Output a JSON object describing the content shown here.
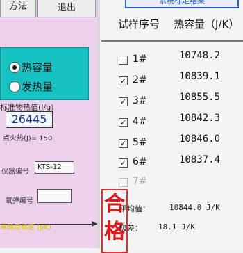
{
  "toolbar": {
    "method_label": "方法",
    "exit_label": "退出"
  },
  "mode": {
    "options": [
      {
        "label": "热容量",
        "selected": true
      },
      {
        "label": "发热量",
        "selected": false
      }
    ]
  },
  "standard": {
    "label": "标准物热值(J/g)",
    "value": "26445",
    "ignition_label": "点火热(J)= 150"
  },
  "instrument": {
    "label": "仪器编号",
    "value": "KTS-12"
  },
  "bomb": {
    "label": "氧弹编号",
    "value": ""
  },
  "footer_left": "准确度标定 (J/K)",
  "banner": "系统标定结果",
  "table": {
    "col1": "试样序号",
    "col2": "热容量（J/K）",
    "rows": [
      {
        "id": "1#",
        "checked": false,
        "value": "10748.2"
      },
      {
        "id": "2#",
        "checked": true,
        "value": "10839.1"
      },
      {
        "id": "3#",
        "checked": true,
        "value": "10855.5"
      },
      {
        "id": "4#",
        "checked": true,
        "value": "10842.3"
      },
      {
        "id": "5#",
        "checked": true,
        "value": "10846.0"
      },
      {
        "id": "6#",
        "checked": true,
        "value": "10837.4"
      },
      {
        "id": "7#",
        "checked": false,
        "value": ""
      }
    ]
  },
  "result": {
    "stamp": "合格",
    "avg_label": "平均值：",
    "avg_value": "10844.0  J/K",
    "range_label": "极差：",
    "range_value": "18.1  J/K"
  }
}
